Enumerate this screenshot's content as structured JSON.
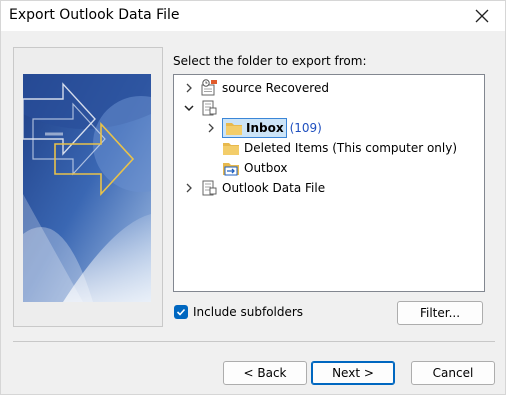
{
  "window": {
    "title": "Export Outlook Data File"
  },
  "prompt": "Select the folder to export from:",
  "tree": {
    "items": [
      {
        "label": "source Recovered",
        "count": ""
      },
      {
        "label": "",
        "count": ""
      },
      {
        "label": "Inbox",
        "count": "(109)"
      },
      {
        "label": "Deleted Items (This computer only)",
        "count": ""
      },
      {
        "label": "Outbox",
        "count": ""
      },
      {
        "label": "Outlook Data File",
        "count": ""
      }
    ]
  },
  "options": {
    "include_subfolders_label": "Include subfolders",
    "include_subfolders_checked": true
  },
  "buttons": {
    "filter": "Filter...",
    "back": "< Back",
    "next": "Next >",
    "cancel": "Cancel"
  },
  "colors": {
    "accent": "#0067c0",
    "selection": "#cce4f7",
    "count_text": "#1f4fbf"
  }
}
